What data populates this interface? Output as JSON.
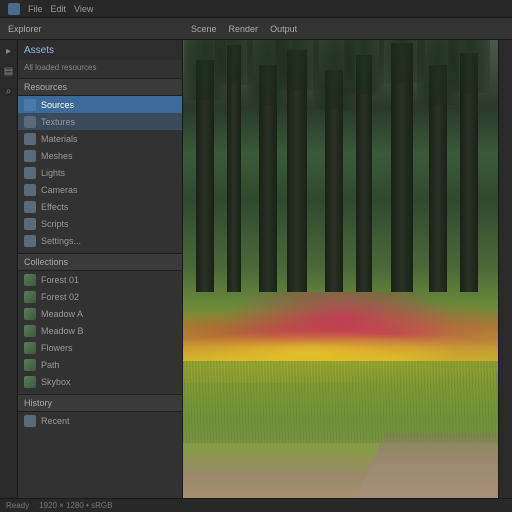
{
  "menubar": {
    "items": [
      "File",
      "Edit",
      "View"
    ]
  },
  "tabbar": {
    "panel_title": "Explorer",
    "tabs": [
      "Scene",
      "Render",
      "Output"
    ]
  },
  "sidebar": {
    "title": "Assets",
    "subtitle": "All loaded resources",
    "section1": "Resources",
    "section1_selected": "Sources",
    "items1": [
      "Textures",
      "Materials",
      "Meshes",
      "Lights",
      "Cameras",
      "Effects",
      "Scripts",
      "Settings..."
    ],
    "section2": "Collections",
    "items2": [
      "Forest 01",
      "Forest 02",
      "Meadow A",
      "Meadow B",
      "Flowers",
      "Path",
      "Skybox"
    ],
    "section3": "History",
    "items3": [
      "Recent"
    ]
  },
  "canvas": {
    "image_desc": "forest-meadow-flowers"
  },
  "statusbar": {
    "left": "Ready",
    "info": "1920 × 1280  •  sRGB"
  },
  "colors": {
    "accent": "#3d6a99",
    "link": "#8bb8e8"
  }
}
